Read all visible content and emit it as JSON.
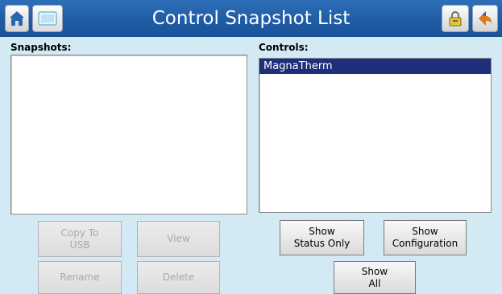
{
  "header": {
    "title": "Control Snapshot List",
    "home_icon": "home-icon",
    "screen_icon": "screen-icon",
    "lock_icon": "lock-icon",
    "back_icon": "back-arrow-icon",
    "bar_color": "#1f5ca6"
  },
  "snapshots": {
    "label": "Snapshots:",
    "items": []
  },
  "controls": {
    "label": "Controls:",
    "items": [
      {
        "label": "MagnaTherm",
        "selected": true
      }
    ],
    "selected_color": "#1f2e7a"
  },
  "buttons": {
    "copy_to_usb": "Copy To\nUSB",
    "view": "View",
    "rename": "Rename",
    "delete": "Delete",
    "show_status_only": "Show\nStatus Only",
    "show_configuration": "Show\nConfiguration",
    "show_all": "Show\nAll"
  },
  "colors": {
    "background": "#d3eaf4",
    "disabled_text": "#a9a9a9"
  }
}
